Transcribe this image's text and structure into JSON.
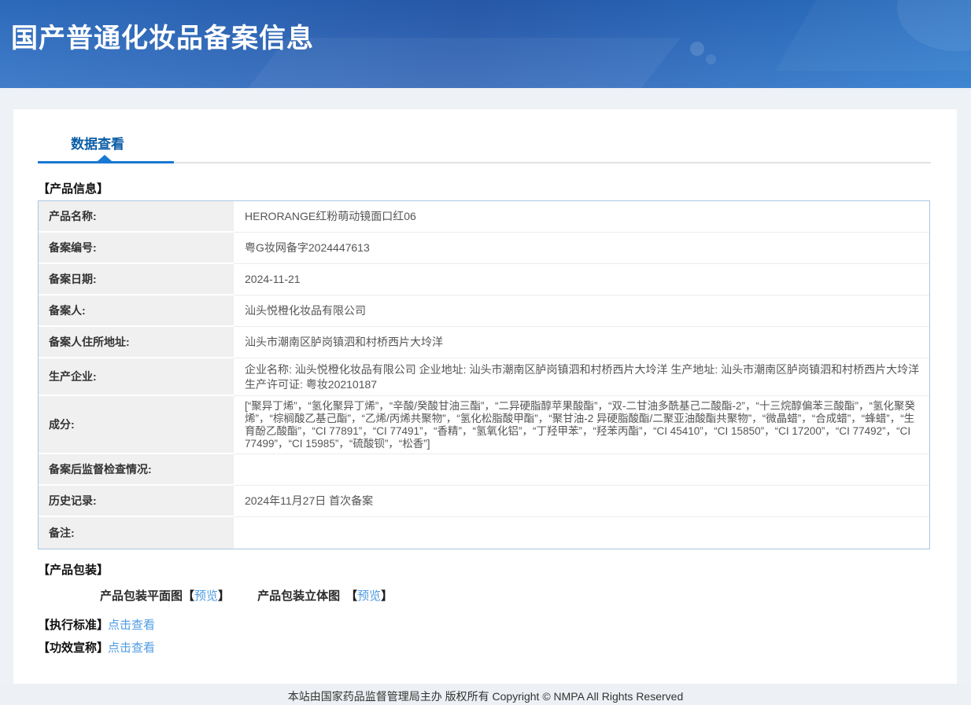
{
  "header": {
    "title": "国产普通化妆品备案信息"
  },
  "tab": {
    "label": "数据查看"
  },
  "section_titles": {
    "product_info": "【产品信息】",
    "packaging": "【产品包装】",
    "exec_standard": "【执行标准】",
    "efficacy_claim": "【功效宣称】"
  },
  "table": {
    "rows": [
      {
        "label": "产品名称:",
        "value": "HERORANGE红粉萌动镜面口红06"
      },
      {
        "label": "备案编号:",
        "value": "粤G妆网备字2024447613"
      },
      {
        "label": "备案日期:",
        "value": "2024-11-21"
      },
      {
        "label": "备案人:",
        "value": "汕头悦橙化妆品有限公司"
      },
      {
        "label": "备案人住所地址:",
        "value": "汕头市潮南区胪岗镇泗和村桥西片大坽洋"
      },
      {
        "label": "生产企业:",
        "value": "企业名称: 汕头悦橙化妆品有限公司 企业地址: 汕头市潮南区胪岗镇泗和村桥西片大坽洋 生产地址: 汕头市潮南区胪岗镇泗和村桥西片大坽洋 生产许可证: 粤妆20210187"
      },
      {
        "label": "成分:",
        "value": "[“聚异丁烯”，“氢化聚异丁烯”，“辛酸/癸酸甘油三酯”，“二异硬脂醇苹果酸酯”，“双-二甘油多酰基己二酸酯-2”，“十三烷醇偏苯三酸酯”，“氢化聚癸烯”，“棕榈酸乙基己酯”，“乙烯/丙烯共聚物”，“氢化松脂酸甲酯”，“聚甘油-2 异硬脂酸酯/二聚亚油酸酯共聚物”，“微晶蜡”，“合成蜡”，“蜂蜡”，“生育酚乙酸酯”，“CI 77891”，“CI 77491”，“香精”，“氢氧化铝”，“丁羟甲苯”，“羟苯丙酯”，“CI 45410”，“CI 15850”，“CI 17200”，“CI 77492”，“CI 77499”，“CI 15985”，“硫酸钡”，“松香”]"
      },
      {
        "label": "备案后监督检查情况:",
        "value": ""
      },
      {
        "label": "历史记录:",
        "value": "2024年11月27日 首次备案"
      },
      {
        "label": "备注:",
        "value": ""
      }
    ]
  },
  "packaging": {
    "flat_label": "产品包装平面图",
    "stereo_label": "产品包装立体图",
    "bracket_open": "【",
    "bracket_close": "】",
    "preview_link": "预览"
  },
  "links": {
    "click_view": "点击查看"
  },
  "footer": {
    "text": "本站由国家药品监督管理局主办 版权所有 Copyright © NMPA All Rights Reserved"
  },
  "colors": {
    "header_gradient_start": "#3173c6",
    "header_gradient_end": "#2f7ccf",
    "tab_text": "#0d5ea6",
    "tab_underline": "#1878d2",
    "link_blue": "#4f9ce2",
    "table_border": "#a9c6e3",
    "label_bg": "#f0f0f0"
  }
}
